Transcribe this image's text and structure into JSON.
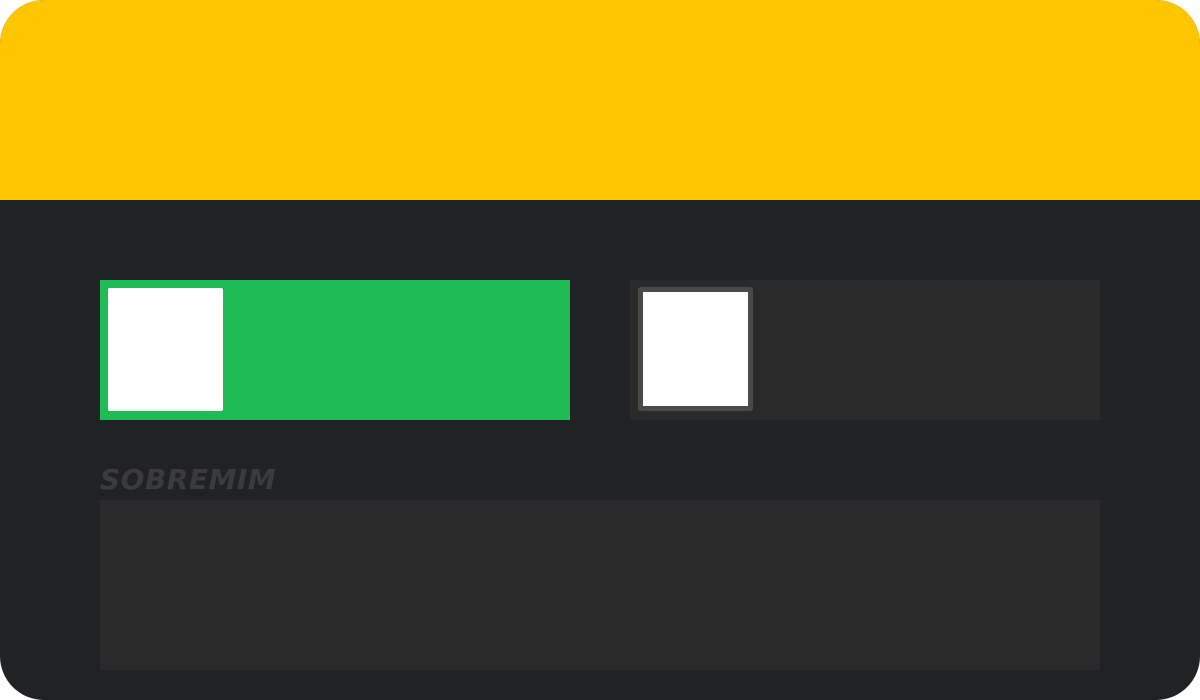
{
  "colors": {
    "banner": "#ffc600",
    "panel_background": "#212226",
    "toggle_on": "#1fbb55",
    "toggle_off": "#2a2a2a",
    "knob": "#ffffff",
    "knob_border_off": "#4a4a4a",
    "textarea_background": "#2a2a2a",
    "label_text": "#3b3b3d"
  },
  "toggles": [
    {
      "state": "on"
    },
    {
      "state": "off"
    }
  ],
  "about": {
    "label": "SOBREMIM",
    "value": ""
  }
}
